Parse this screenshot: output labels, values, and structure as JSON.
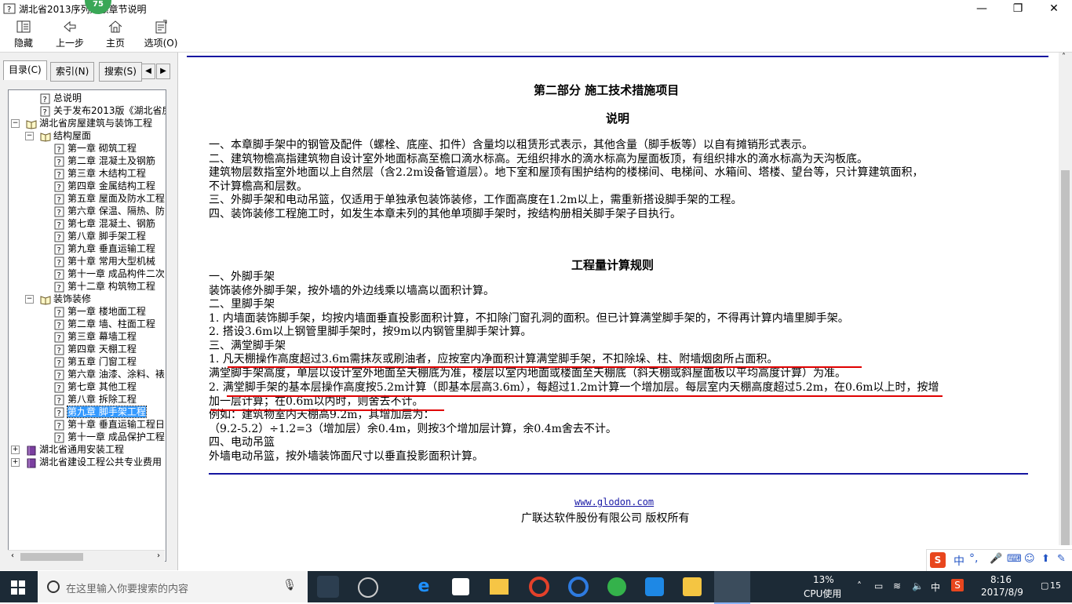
{
  "window": {
    "title": "湖北省2013序列定额章节说明",
    "badge": "75",
    "controls": [
      "—",
      "❐",
      "✕"
    ]
  },
  "toolbar": {
    "hide": "隐藏",
    "back": "上一步",
    "home": "主页",
    "options": "选项(O)"
  },
  "nav_tabs": {
    "contents": "目录(C)",
    "index": "索引(N)",
    "search": "搜索(S)"
  },
  "tree": [
    {
      "label": "总说明",
      "level": 1,
      "type": "page"
    },
    {
      "label": "关于发布2013版《湖北省房屋",
      "level": 1,
      "type": "page"
    },
    {
      "label": "湖北省房屋建筑与装饰工程",
      "level": 0,
      "type": "book-open"
    },
    {
      "label": "结构屋面",
      "level": 1,
      "type": "book-open"
    },
    {
      "label": "第一章  砌筑工程",
      "level": 2,
      "type": "page"
    },
    {
      "label": "第二章  混凝土及钢筋",
      "level": 2,
      "type": "page"
    },
    {
      "label": "第三章  木结构工程",
      "level": 2,
      "type": "page"
    },
    {
      "label": "第四章  金属结构工程",
      "level": 2,
      "type": "page"
    },
    {
      "label": "第五章  屋面及防水工程",
      "level": 2,
      "type": "page"
    },
    {
      "label": "第六章  保温、隔热、防",
      "level": 2,
      "type": "page"
    },
    {
      "label": "第七章  混凝土、钢筋",
      "level": 2,
      "type": "page"
    },
    {
      "label": "第八章  脚手架工程",
      "level": 2,
      "type": "page"
    },
    {
      "label": "第九章  垂直运输工程",
      "level": 2,
      "type": "page"
    },
    {
      "label": "第十章  常用大型机械",
      "level": 2,
      "type": "page"
    },
    {
      "label": "第十一章  成品构件二次",
      "level": 2,
      "type": "page"
    },
    {
      "label": "第十二章  构筑物工程",
      "level": 2,
      "type": "page"
    },
    {
      "label": "装饰装修",
      "level": 1,
      "type": "book-open"
    },
    {
      "label": "第一章  楼地面工程",
      "level": 2,
      "type": "page"
    },
    {
      "label": "第二章  墙、柱面工程",
      "level": 2,
      "type": "page"
    },
    {
      "label": "第三章  幕墙工程",
      "level": 2,
      "type": "page"
    },
    {
      "label": "第四章  天棚工程",
      "level": 2,
      "type": "page"
    },
    {
      "label": "第五章  门窗工程",
      "level": 2,
      "type": "page"
    },
    {
      "label": "第六章  油漆、涂料、裱",
      "level": 2,
      "type": "page"
    },
    {
      "label": "第七章  其他工程",
      "level": 2,
      "type": "page"
    },
    {
      "label": "第八章  拆除工程",
      "level": 2,
      "type": "page"
    },
    {
      "label": "第九章  脚手架工程",
      "level": 2,
      "type": "page",
      "selected": true
    },
    {
      "label": "第十章  垂直运输工程日",
      "level": 2,
      "type": "page"
    },
    {
      "label": "第十一章  成品保护工程",
      "level": 2,
      "type": "page"
    },
    {
      "label": "湖北省通用安装工程",
      "level": 0,
      "type": "book-closed"
    },
    {
      "label": "湖北省建设工程公共专业费用",
      "level": 0,
      "type": "book-closed"
    }
  ],
  "doc": {
    "part_title": "第二部分  施工技术措施项目",
    "desc_title": "说明",
    "desc_lines": [
      "一、本章脚手架中的钢管及配件（螺栓、底座、扣件）含量均以租赁形式表示，其他含量（脚手板等）以自有摊销形式表示。",
      "二、建筑物檐高指建筑物自设计室外地面标高至檐口滴水标高。无组织排水的滴水标高为屋面板顶，有组织排水的滴水标高为天沟板底。",
      "建筑物层数指室外地面以上自然层（含2.2m设备管道层）。地下室和屋顶有围护结构的楼梯间、电梯间、水箱间、塔楼、望台等，只计算建筑面积，",
      "不计算檐高和层数。",
      "三、外脚手架和电动吊篮，仅适用于单独承包装饰装修，工作面高度在1.2m以上，需重新搭设脚手架的工程。",
      "四、装饰装修工程施工时，如发生本章未列的其他单项脚手架时，按结构册相关脚手架子目执行。"
    ],
    "rules_title": "工程量计算规则",
    "rules_lines": [
      "一、外脚手架",
      "装饰装修外脚手架，按外墙的外边线乘以墙高以面积计算。",
      "二、里脚手架",
      "1. 内墙面装饰脚手架，均按内墙面垂直投影面积计算，不扣除门窗孔洞的面积。但已计算满堂脚手架的，不得再计算内墙里脚手架。",
      "2. 搭设3.6m以上钢管里脚手架时，按9m以内钢管里脚手架计算。",
      "三、满堂脚手架",
      "1. 凡天棚操作高度超过3.6m需抹灰或刷油者，应按室内净面积计算满堂脚手架，不扣除垛、柱、附墙烟囱所占面积。",
      "满堂脚手架高度，单层以设计室外地面至天棚底为准，楼层以室内地面或楼面至天棚底（斜天棚或斜屋面板以平均高度计算）为准。",
      "2. 满堂脚手架的基本层操作高度按5.2m计算（即基本层高3.6m），每超过1.2m计算一个增加层。每层室内天棚高度超过5.2m，在0.6m以上时，按增",
      "加一层计算；在0.6m以内时，则舍去不计。",
      "例如：建筑物室内天棚高9.2m，其增加层为：",
      "（9.2-5.2）÷1.2=3（增加层）余0.4m，则按3个增加层计算，余0.4m舍去不计。",
      "四、电动吊篮",
      "外墙电动吊篮，按外墙装饰面尺寸以垂直投影面积计算。"
    ],
    "footer_link": "www.glodon.com",
    "footer_copyright": "广联达软件股份有限公司 版权所有"
  },
  "taskbar": {
    "search_placeholder": "在这里输入你要搜索的内容",
    "cpu_percent": "13%",
    "cpu_label": "CPU使用",
    "ime_lang": "中",
    "time": "8:16",
    "date": "2017/8/9",
    "notifications": "15"
  },
  "ime_bar": {
    "lang": "中",
    "punct": "°,"
  },
  "colors": {
    "doc_rule": "#1515a0",
    "underline": "#e00000",
    "taskbar": "#1c2a36",
    "badge": "#3aa757",
    "selection": "#3399ff"
  }
}
